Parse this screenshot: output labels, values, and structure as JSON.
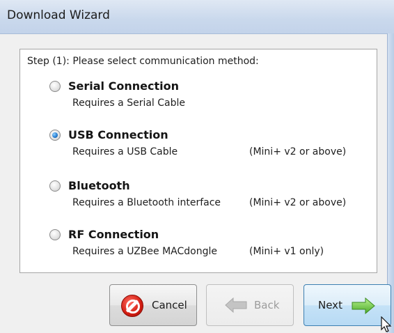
{
  "window": {
    "title": "Download Wizard"
  },
  "panel": {
    "step_label": "Step (1): Please select communication method:",
    "options": [
      {
        "title": "Serial Connection",
        "description": "Requires a Serial Cable",
        "note": "",
        "selected": false
      },
      {
        "title": "USB Connection",
        "description": "Requires a USB Cable",
        "note": "(Mini+ v2 or above)",
        "selected": true
      },
      {
        "title": "Bluetooth",
        "description": "Requires a Bluetooth interface",
        "note": "(Mini+ v2 or above)",
        "selected": false
      },
      {
        "title": "RF Connection",
        "description": "Requires a UZBee MACdongle",
        "note": "(Mini+ v1 only)",
        "selected": false
      }
    ]
  },
  "buttons": {
    "cancel_label": "Cancel",
    "back_label": "Back",
    "next_label": "Next"
  },
  "icons": {
    "cancel": "cancel-icon",
    "back": "arrow-left-icon",
    "next": "arrow-right-icon",
    "cursor": "mouse-pointer-icon"
  },
  "colors": {
    "selected_radio": "#2a7fd3",
    "next_arrow": "#5cc13a",
    "cancel_icon": "#d21d12"
  }
}
